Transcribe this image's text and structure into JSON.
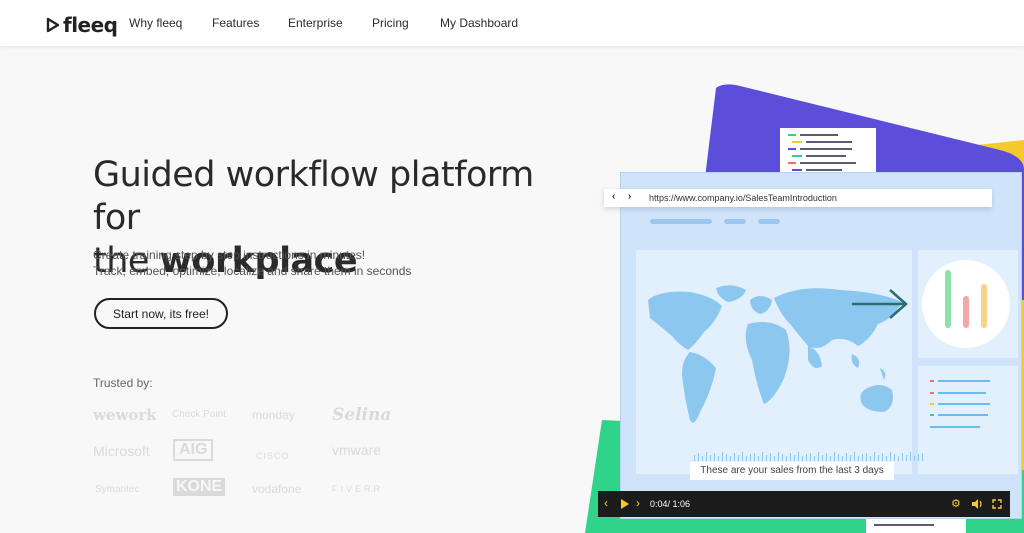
{
  "nav": {
    "logo": "fleeq",
    "links": [
      "Why fleeq",
      "Features",
      "Enterprise",
      "Pricing",
      "My Dashboard"
    ]
  },
  "hero": {
    "title_line1": "Guided workflow platform for",
    "title_prefix": "the",
    "title_emphasis": "workplace",
    "subtitle_line1": "Create training step by step instructions in minutes!",
    "subtitle_line2": "Track, embed, optimize, localize and share them in seconds",
    "cta": "Start now, its free!"
  },
  "trusted": {
    "label": "Trusted by:",
    "brands": [
      "wework",
      "Check Point",
      "monday",
      "Selina",
      "Microsoft",
      "AIG",
      "CISCO",
      "vmware",
      "Symantec",
      "KONE",
      "vodafone",
      "FIVERR"
    ]
  },
  "illustration": {
    "url": "https://www.company.io/SalesTeamIntroduction",
    "caption": "These are your sales from the last 3 days",
    "time": "0:04/ 1:06",
    "colors": {
      "purple": "#5b4fd9",
      "yellow": "#f6c92f",
      "green": "#2fd48a",
      "panel": "#cfe4fb",
      "map": "#8cc7f0",
      "arrow": "#2c6b73"
    }
  }
}
